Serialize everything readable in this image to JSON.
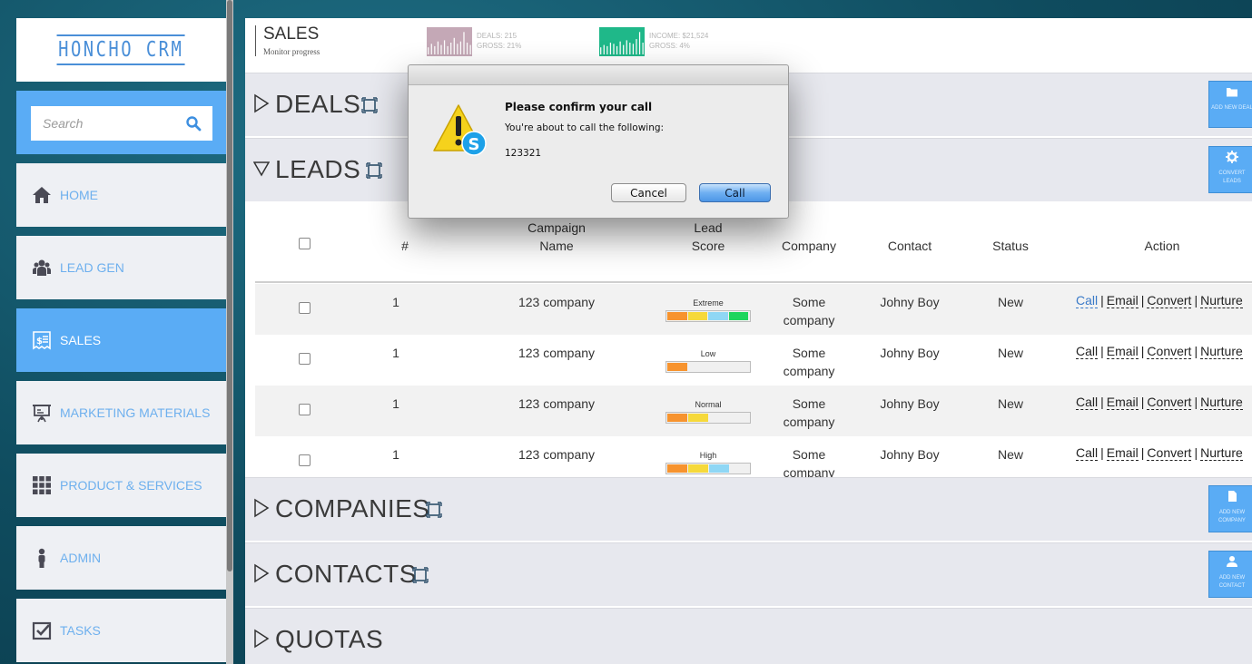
{
  "app": {
    "logo": "HONCHO CRM"
  },
  "search": {
    "placeholder": "Search"
  },
  "nav": [
    {
      "label": "HOME",
      "icon": "home-icon",
      "active": false
    },
    {
      "label": "LEAD GEN",
      "icon": "people-icon",
      "active": false
    },
    {
      "label": "SALES",
      "icon": "receipt-icon",
      "active": true
    },
    {
      "label": "MARKETING MATERIALS",
      "icon": "presentation-icon",
      "active": false
    },
    {
      "label": "PRODUCT & SERVICES",
      "icon": "grid-icon",
      "active": false
    },
    {
      "label": "ADMIN",
      "icon": "person-icon",
      "active": false
    },
    {
      "label": "TASKS",
      "icon": "checkbox-icon",
      "active": false
    }
  ],
  "header": {
    "title": "SALES",
    "subtitle": "Monitor progress",
    "stat1": {
      "line1": "DEALS: 215",
      "line2": "GROSS: 21%",
      "color": "#c4a8b6",
      "bars": [
        0.3,
        0.45,
        0.35,
        0.55,
        0.4,
        0.6,
        0.35,
        0.5,
        0.7,
        0.45,
        0.55,
        0.95,
        0.5,
        0.4
      ]
    },
    "stat2": {
      "line1": "INCOME: $21,524",
      "line2": "GROSS: 4%",
      "color": "#1fb889",
      "bars": [
        0.3,
        0.4,
        0.35,
        0.5,
        0.45,
        0.35,
        0.55,
        0.4,
        0.6,
        0.5,
        0.45,
        0.65,
        0.95,
        0.5
      ]
    }
  },
  "sections": {
    "deals": {
      "title": "DEALS",
      "button": "ADD NEW DEAL"
    },
    "leads": {
      "title": "LEADS",
      "button": "CONVERT LEADS"
    },
    "companies": {
      "title": "COMPANIES",
      "button": "ADD NEW COMPANY"
    },
    "contacts": {
      "title": "CONTACTS",
      "button": "ADD NEW CONTACT"
    },
    "quotas": {
      "title": "QUOTAS"
    }
  },
  "leads_table": {
    "headers": {
      "num": "#",
      "campaign_1": "Campaign",
      "campaign_2": "Name",
      "score_1": "Lead",
      "score_2": "Score",
      "company": "Company",
      "contact": "Contact",
      "status": "Status",
      "action": "Action"
    },
    "rows": [
      {
        "num": "1",
        "campaign": "123 company",
        "score_label": "Extreme",
        "score_level": 4,
        "company_1": "Some",
        "company_2": "company",
        "contact": "Johny Boy",
        "status": "New"
      },
      {
        "num": "1",
        "campaign": "123 company",
        "score_label": "Low",
        "score_level": 1,
        "company_1": "Some",
        "company_2": "company",
        "contact": "Johny Boy",
        "status": "New"
      },
      {
        "num": "1",
        "campaign": "123 company",
        "score_label": "Normal",
        "score_level": 2,
        "company_1": "Some",
        "company_2": "company",
        "contact": "Johny Boy",
        "status": "New"
      },
      {
        "num": "1",
        "campaign": "123 company",
        "score_label": "High",
        "score_level": 3,
        "company_1": "Some",
        "company_2": "company",
        "contact": "Johny Boy",
        "status": "New"
      }
    ],
    "actions": {
      "call": "Call",
      "email": "Email",
      "convert": "Convert",
      "nurture": "Nurture",
      "sep": "|"
    },
    "score_colors": [
      "#f7932e",
      "#f6d93a",
      "#8fd7f5",
      "#1fd55d"
    ]
  },
  "dialog": {
    "title": "Please confirm your call",
    "message": "You're about to call the following:",
    "number": "123321",
    "cancel": "Cancel",
    "confirm": "Call"
  }
}
